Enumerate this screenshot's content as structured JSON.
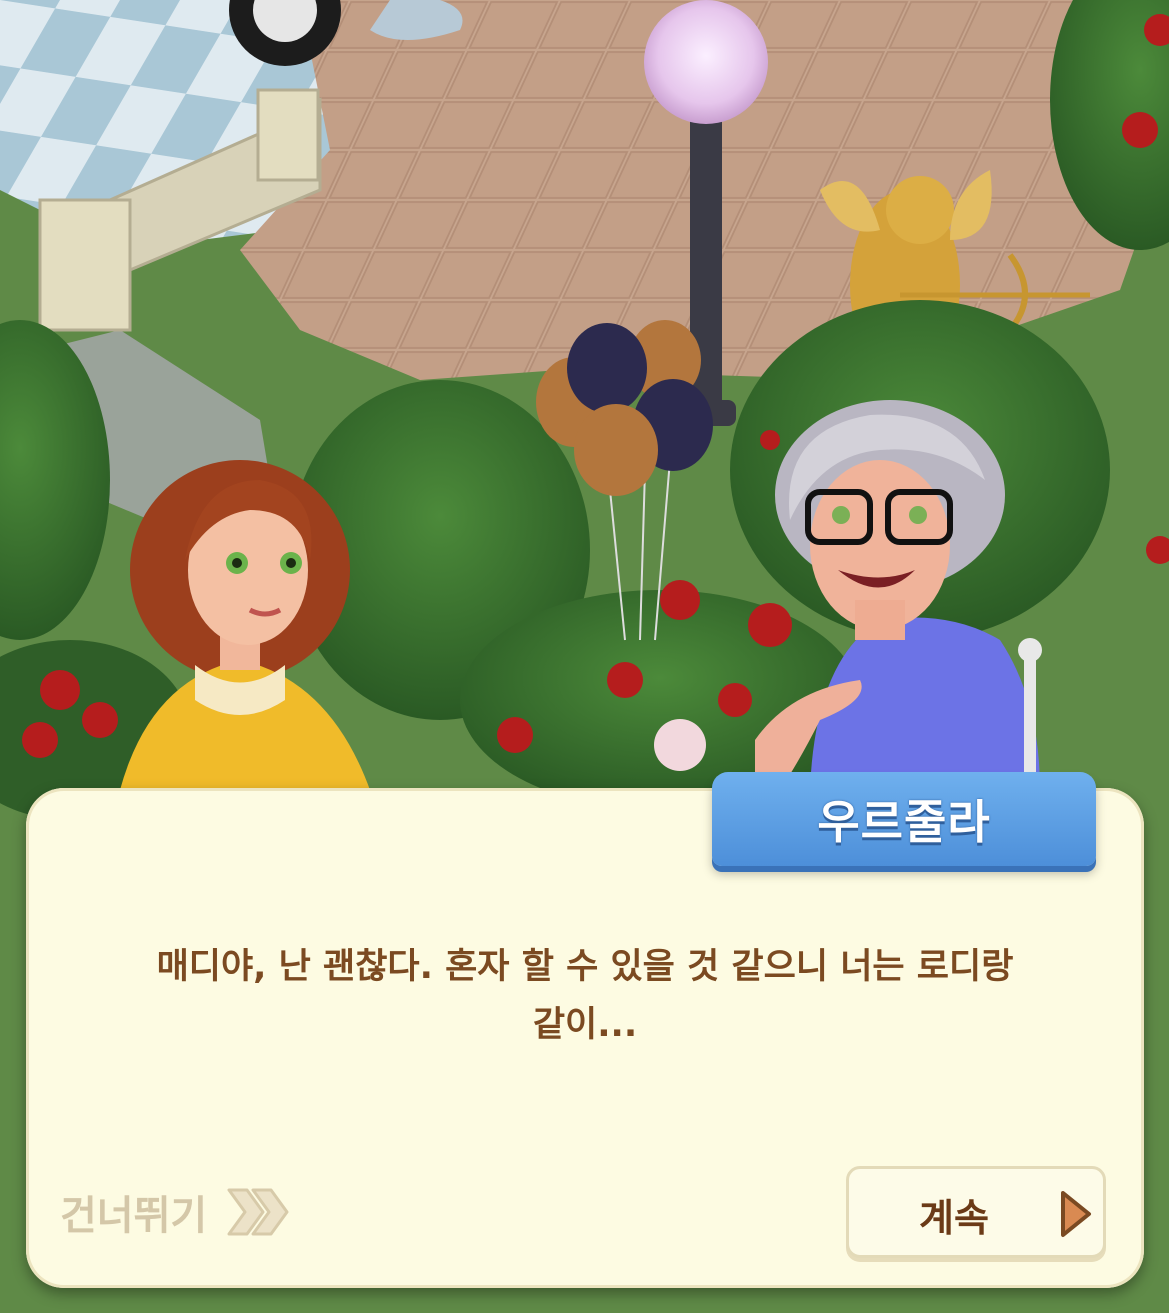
{
  "dialog": {
    "speaker_name": "우르줄라",
    "line_1": "매디야, 난 괜찮다. 혼자 할 수 있을 것 같으니 너는 로디랑",
    "line_2": "같이...",
    "skip_label": "건너뛰기",
    "continue_label": "계속",
    "skip_icon": "double-chevron-right-icon",
    "continue_icon": "play-triangle-icon"
  },
  "colors": {
    "dialog_bg": "#fdfbe2",
    "name_tag": "#5a9de4",
    "dialog_text": "#7b4a21",
    "skip_text": "#d4c7a8",
    "continue_icon": "#d98a52"
  }
}
